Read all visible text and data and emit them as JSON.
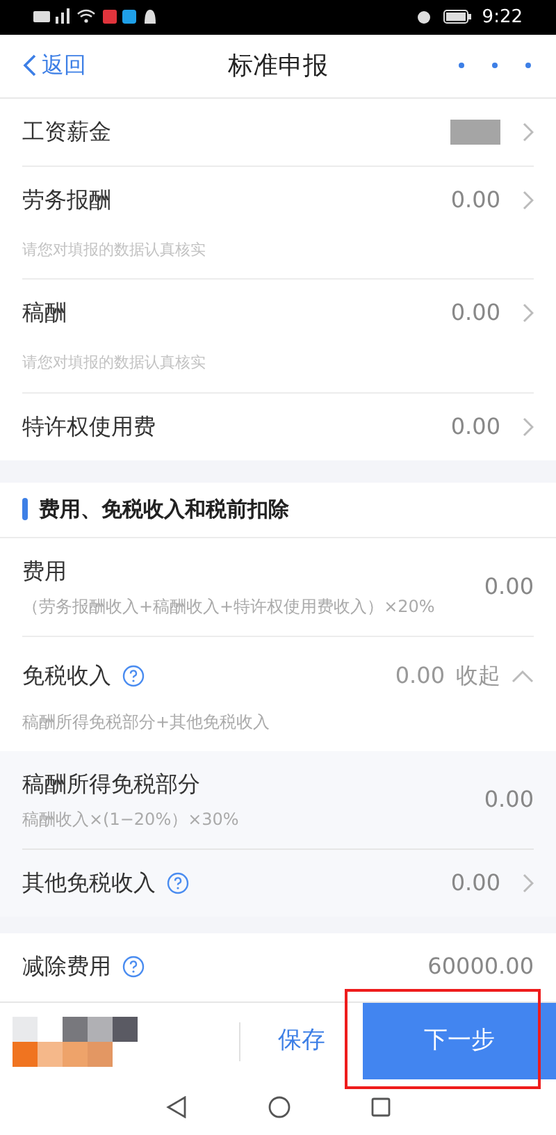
{
  "status_bar": {
    "time": "9:22"
  },
  "nav": {
    "back": "返回",
    "title": "标准申报"
  },
  "income_rows": [
    {
      "label": "工资薪金",
      "kind": "redacted"
    },
    {
      "label": "劳务报酬",
      "kind": "amount",
      "value": "0.00",
      "hint": "请您对填报的数据认真核实"
    },
    {
      "label": "稿酬",
      "kind": "amount",
      "value": "0.00",
      "hint": "请您对填报的数据认真核实"
    },
    {
      "label": "特许权使用费",
      "kind": "amount",
      "value": "0.00"
    }
  ],
  "section": {
    "title": "费用、免税收入和税前扣除"
  },
  "expense": {
    "label": "费用",
    "formula": "（劳务报酬收入+稿酬收入+特许权使用费收入）×20%",
    "value": "0.00"
  },
  "tax_free": {
    "label": "免税收入",
    "value": "0.00",
    "toggle": "收起",
    "expanded": true,
    "note": "稿酬所得免税部分+其他免税收入",
    "children": [
      {
        "label": "稿酬所得免税部分",
        "formula": "稿酬收入×(1−20%）×30%",
        "value": "0.00",
        "kind": "plain"
      },
      {
        "label": "其他免税收入",
        "value": "0.00",
        "kind": "help-link"
      }
    ]
  },
  "deduction": {
    "label": "减除费用",
    "value": "60000.00"
  },
  "footer": {
    "save": "保存",
    "next": "下一步",
    "highlighted": true
  }
}
